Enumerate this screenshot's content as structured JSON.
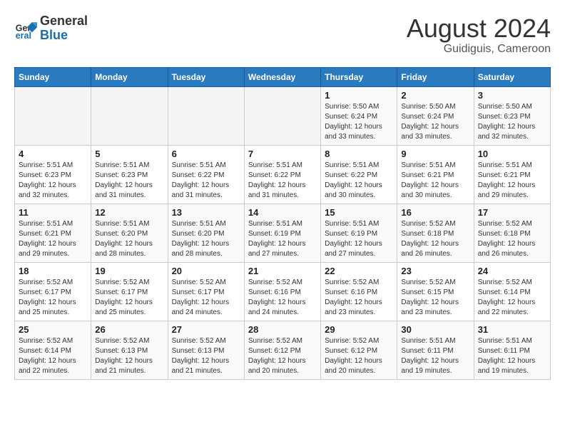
{
  "logo": {
    "general": "General",
    "blue": "Blue"
  },
  "header": {
    "month": "August 2024",
    "location": "Guidiguis, Cameroon"
  },
  "weekdays": [
    "Sunday",
    "Monday",
    "Tuesday",
    "Wednesday",
    "Thursday",
    "Friday",
    "Saturday"
  ],
  "weeks": [
    [
      {
        "day": "",
        "info": ""
      },
      {
        "day": "",
        "info": ""
      },
      {
        "day": "",
        "info": ""
      },
      {
        "day": "",
        "info": ""
      },
      {
        "day": "1",
        "info": "Sunrise: 5:50 AM\nSunset: 6:24 PM\nDaylight: 12 hours and 33 minutes."
      },
      {
        "day": "2",
        "info": "Sunrise: 5:50 AM\nSunset: 6:24 PM\nDaylight: 12 hours and 33 minutes."
      },
      {
        "day": "3",
        "info": "Sunrise: 5:50 AM\nSunset: 6:23 PM\nDaylight: 12 hours and 32 minutes."
      }
    ],
    [
      {
        "day": "4",
        "info": "Sunrise: 5:51 AM\nSunset: 6:23 PM\nDaylight: 12 hours and 32 minutes."
      },
      {
        "day": "5",
        "info": "Sunrise: 5:51 AM\nSunset: 6:23 PM\nDaylight: 12 hours and 31 minutes."
      },
      {
        "day": "6",
        "info": "Sunrise: 5:51 AM\nSunset: 6:22 PM\nDaylight: 12 hours and 31 minutes."
      },
      {
        "day": "7",
        "info": "Sunrise: 5:51 AM\nSunset: 6:22 PM\nDaylight: 12 hours and 31 minutes."
      },
      {
        "day": "8",
        "info": "Sunrise: 5:51 AM\nSunset: 6:22 PM\nDaylight: 12 hours and 30 minutes."
      },
      {
        "day": "9",
        "info": "Sunrise: 5:51 AM\nSunset: 6:21 PM\nDaylight: 12 hours and 30 minutes."
      },
      {
        "day": "10",
        "info": "Sunrise: 5:51 AM\nSunset: 6:21 PM\nDaylight: 12 hours and 29 minutes."
      }
    ],
    [
      {
        "day": "11",
        "info": "Sunrise: 5:51 AM\nSunset: 6:21 PM\nDaylight: 12 hours and 29 minutes."
      },
      {
        "day": "12",
        "info": "Sunrise: 5:51 AM\nSunset: 6:20 PM\nDaylight: 12 hours and 28 minutes."
      },
      {
        "day": "13",
        "info": "Sunrise: 5:51 AM\nSunset: 6:20 PM\nDaylight: 12 hours and 28 minutes."
      },
      {
        "day": "14",
        "info": "Sunrise: 5:51 AM\nSunset: 6:19 PM\nDaylight: 12 hours and 27 minutes."
      },
      {
        "day": "15",
        "info": "Sunrise: 5:51 AM\nSunset: 6:19 PM\nDaylight: 12 hours and 27 minutes."
      },
      {
        "day": "16",
        "info": "Sunrise: 5:52 AM\nSunset: 6:18 PM\nDaylight: 12 hours and 26 minutes."
      },
      {
        "day": "17",
        "info": "Sunrise: 5:52 AM\nSunset: 6:18 PM\nDaylight: 12 hours and 26 minutes."
      }
    ],
    [
      {
        "day": "18",
        "info": "Sunrise: 5:52 AM\nSunset: 6:17 PM\nDaylight: 12 hours and 25 minutes."
      },
      {
        "day": "19",
        "info": "Sunrise: 5:52 AM\nSunset: 6:17 PM\nDaylight: 12 hours and 25 minutes."
      },
      {
        "day": "20",
        "info": "Sunrise: 5:52 AM\nSunset: 6:17 PM\nDaylight: 12 hours and 24 minutes."
      },
      {
        "day": "21",
        "info": "Sunrise: 5:52 AM\nSunset: 6:16 PM\nDaylight: 12 hours and 24 minutes."
      },
      {
        "day": "22",
        "info": "Sunrise: 5:52 AM\nSunset: 6:16 PM\nDaylight: 12 hours and 23 minutes."
      },
      {
        "day": "23",
        "info": "Sunrise: 5:52 AM\nSunset: 6:15 PM\nDaylight: 12 hours and 23 minutes."
      },
      {
        "day": "24",
        "info": "Sunrise: 5:52 AM\nSunset: 6:14 PM\nDaylight: 12 hours and 22 minutes."
      }
    ],
    [
      {
        "day": "25",
        "info": "Sunrise: 5:52 AM\nSunset: 6:14 PM\nDaylight: 12 hours and 22 minutes."
      },
      {
        "day": "26",
        "info": "Sunrise: 5:52 AM\nSunset: 6:13 PM\nDaylight: 12 hours and 21 minutes."
      },
      {
        "day": "27",
        "info": "Sunrise: 5:52 AM\nSunset: 6:13 PM\nDaylight: 12 hours and 21 minutes."
      },
      {
        "day": "28",
        "info": "Sunrise: 5:52 AM\nSunset: 6:12 PM\nDaylight: 12 hours and 20 minutes."
      },
      {
        "day": "29",
        "info": "Sunrise: 5:52 AM\nSunset: 6:12 PM\nDaylight: 12 hours and 20 minutes."
      },
      {
        "day": "30",
        "info": "Sunrise: 5:51 AM\nSunset: 6:11 PM\nDaylight: 12 hours and 19 minutes."
      },
      {
        "day": "31",
        "info": "Sunrise: 5:51 AM\nSunset: 6:11 PM\nDaylight: 12 hours and 19 minutes."
      }
    ]
  ]
}
